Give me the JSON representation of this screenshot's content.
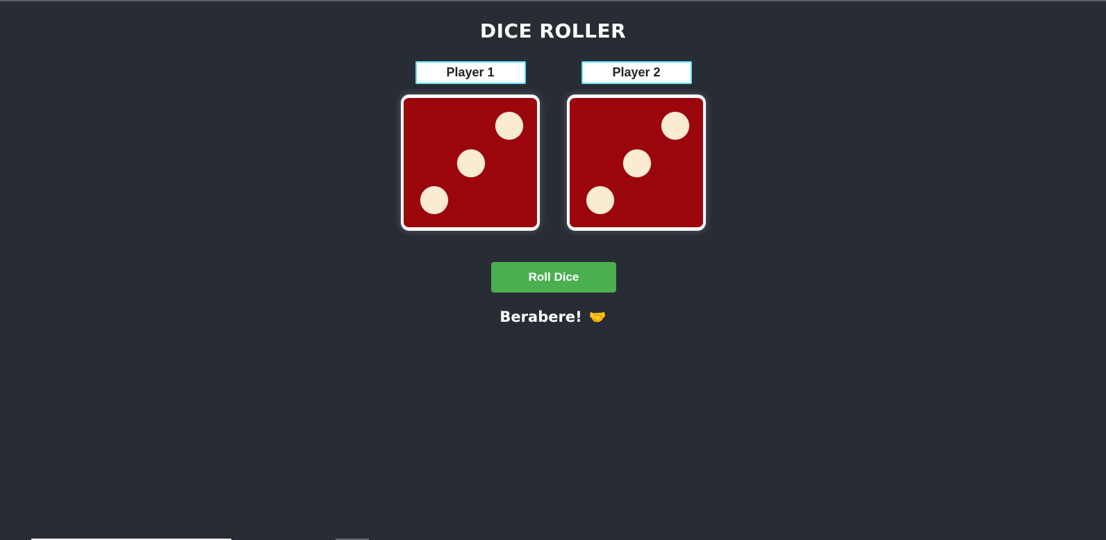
{
  "app": {
    "title": "DICE ROLLER"
  },
  "players": [
    {
      "name": "Player 1",
      "die_value": 3
    },
    {
      "name": "Player 2",
      "die_value": 3
    }
  ],
  "controls": {
    "roll_label": "Roll Dice"
  },
  "result": {
    "text": "Berabere!",
    "icon": "handshake-icon",
    "icon_glyph": "🤝"
  },
  "colors": {
    "background": "#282c34",
    "die_face": "#9b050c",
    "pip": "#fbebd2",
    "button": "#4caf50",
    "name_border": "#61dafb"
  }
}
